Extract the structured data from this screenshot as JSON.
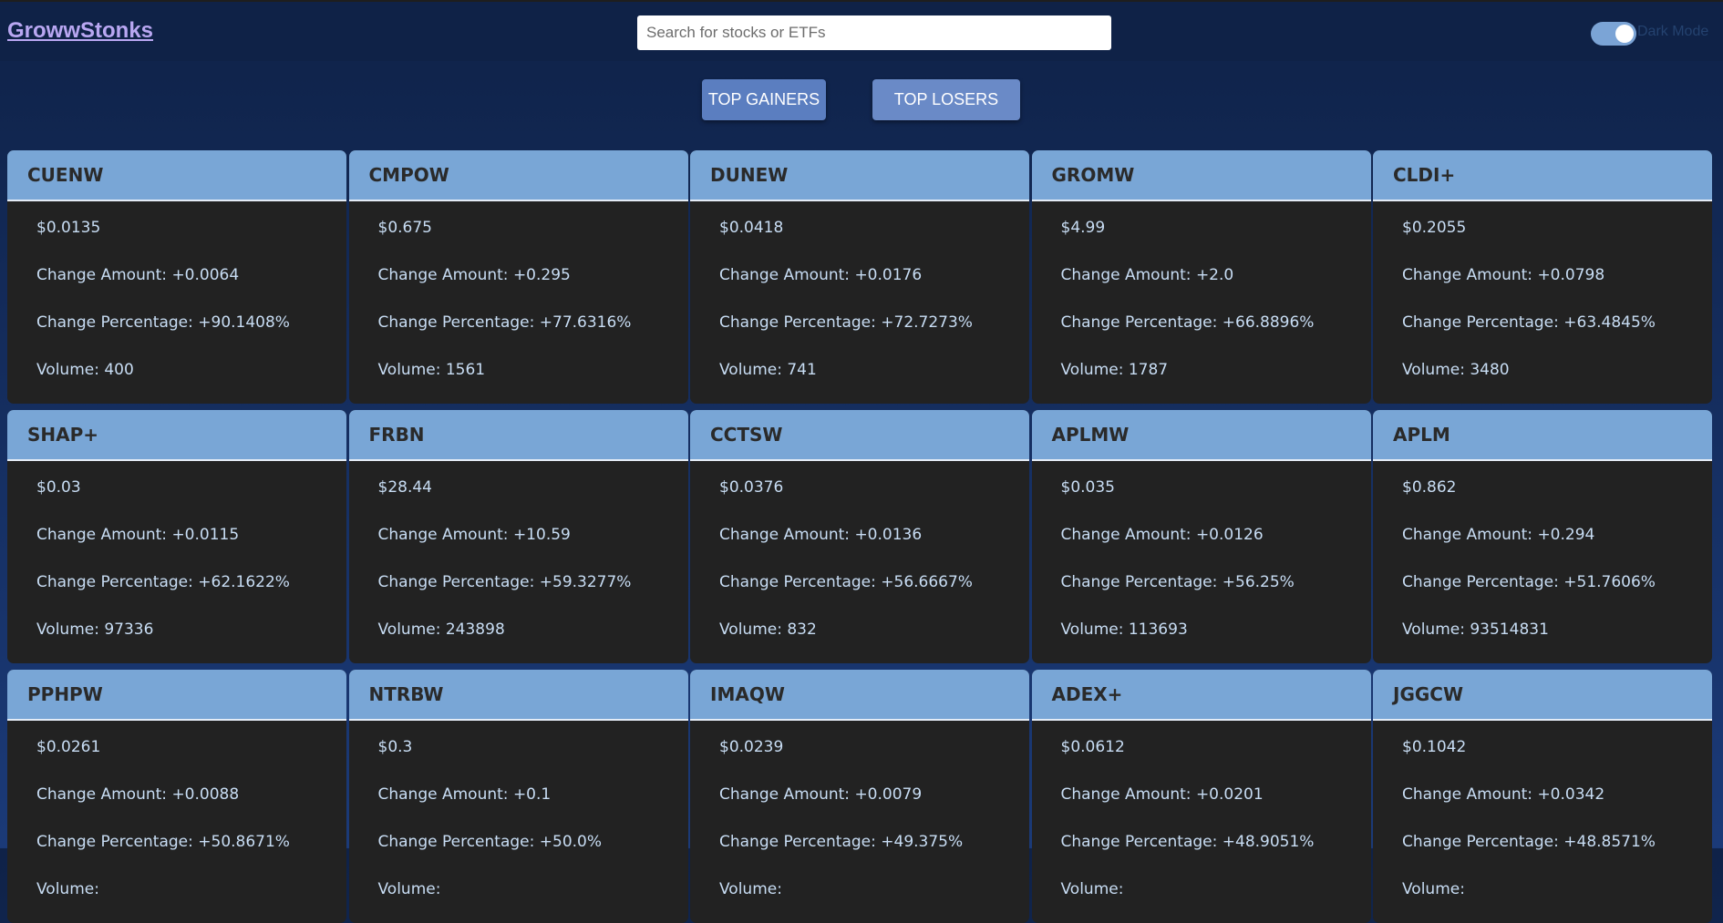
{
  "header": {
    "brand": "GrowwStonks",
    "search_placeholder": "Search for stocks or ETFs",
    "dark_mode_label": "Dark Mode",
    "dark_mode_on": true
  },
  "tabs": [
    {
      "label": "TOP GAINERS",
      "active": true
    },
    {
      "label": "TOP LOSERS",
      "active": false
    }
  ],
  "labels": {
    "change_amount": "Change Amount: ",
    "change_percentage": "Change Percentage: ",
    "volume": "Volume: "
  },
  "stocks": [
    {
      "ticker": "CUENW",
      "price": "$0.0135",
      "change_amount": "+0.0064",
      "change_percentage": "+90.1408%",
      "volume": "400"
    },
    {
      "ticker": "CMPOW",
      "price": "$0.675",
      "change_amount": "+0.295",
      "change_percentage": "+77.6316%",
      "volume": "1561"
    },
    {
      "ticker": "DUNEW",
      "price": "$0.0418",
      "change_amount": "+0.0176",
      "change_percentage": "+72.7273%",
      "volume": "741"
    },
    {
      "ticker": "GROMW",
      "price": "$4.99",
      "change_amount": "+2.0",
      "change_percentage": "+66.8896%",
      "volume": "1787"
    },
    {
      "ticker": "CLDI+",
      "price": "$0.2055",
      "change_amount": "+0.0798",
      "change_percentage": "+63.4845%",
      "volume": "3480"
    },
    {
      "ticker": "SHAP+",
      "price": "$0.03",
      "change_amount": "+0.0115",
      "change_percentage": "+62.1622%",
      "volume": "97336"
    },
    {
      "ticker": "FRBN",
      "price": "$28.44",
      "change_amount": "+10.59",
      "change_percentage": "+59.3277%",
      "volume": "243898"
    },
    {
      "ticker": "CCTSW",
      "price": "$0.0376",
      "change_amount": "+0.0136",
      "change_percentage": "+56.6667%",
      "volume": "832"
    },
    {
      "ticker": "APLMW",
      "price": "$0.035",
      "change_amount": "+0.0126",
      "change_percentage": "+56.25%",
      "volume": "113693"
    },
    {
      "ticker": "APLM",
      "price": "$0.862",
      "change_amount": "+0.294",
      "change_percentage": "+51.7606%",
      "volume": "93514831"
    },
    {
      "ticker": "PPHPW",
      "price": "$0.0261",
      "change_amount": "+0.0088",
      "change_percentage": "+50.8671%",
      "volume": ""
    },
    {
      "ticker": "NTRBW",
      "price": "$0.3",
      "change_amount": "+0.1",
      "change_percentage": "+50.0%",
      "volume": ""
    },
    {
      "ticker": "IMAQW",
      "price": "$0.0239",
      "change_amount": "+0.0079",
      "change_percentage": "+49.375%",
      "volume": ""
    },
    {
      "ticker": "ADEX+",
      "price": "$0.0612",
      "change_amount": "+0.0201",
      "change_percentage": "+48.9051%",
      "volume": ""
    },
    {
      "ticker": "JGGCW",
      "price": "$0.1042",
      "change_amount": "+0.0342",
      "change_percentage": "+48.8571%",
      "volume": ""
    }
  ]
}
